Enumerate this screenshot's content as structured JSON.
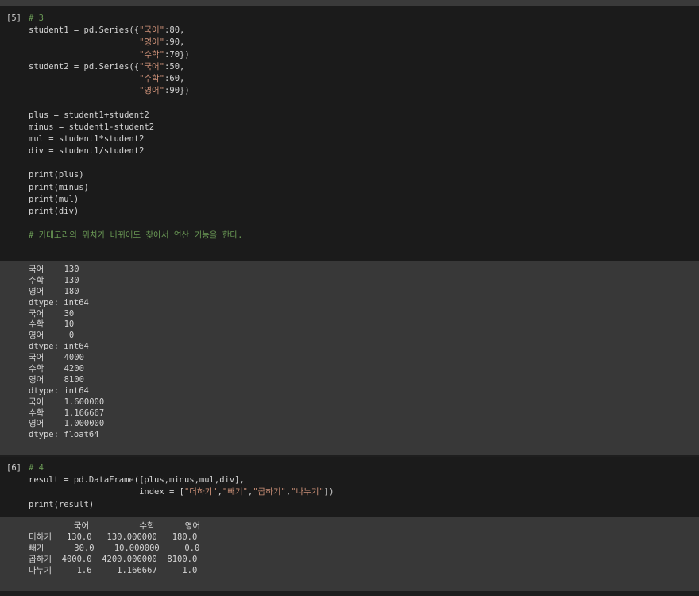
{
  "cells": [
    {
      "prompt": "[5]",
      "code_lines": [
        [
          {
            "t": "# 3",
            "c": "cm"
          }
        ],
        [
          {
            "t": "student1 = pd.Series({",
            "c": "txt"
          },
          {
            "t": "\"국어\"",
            "c": "str"
          },
          {
            "t": ":80,",
            "c": "txt"
          }
        ],
        [
          {
            "t": "                      ",
            "c": "txt"
          },
          {
            "t": "\"영어\"",
            "c": "str"
          },
          {
            "t": ":90,",
            "c": "txt"
          }
        ],
        [
          {
            "t": "                      ",
            "c": "txt"
          },
          {
            "t": "\"수학\"",
            "c": "str"
          },
          {
            "t": ":70})",
            "c": "txt"
          }
        ],
        [
          {
            "t": "student2 = pd.Series({",
            "c": "txt"
          },
          {
            "t": "\"국어\"",
            "c": "str"
          },
          {
            "t": ":50,",
            "c": "txt"
          }
        ],
        [
          {
            "t": "                      ",
            "c": "txt"
          },
          {
            "t": "\"수학\"",
            "c": "str"
          },
          {
            "t": ":60,",
            "c": "txt"
          }
        ],
        [
          {
            "t": "                      ",
            "c": "txt"
          },
          {
            "t": "\"영어\"",
            "c": "str"
          },
          {
            "t": ":90})",
            "c": "txt"
          }
        ],
        [
          {
            "t": "",
            "c": "txt"
          }
        ],
        [
          {
            "t": "plus = student1+student2",
            "c": "txt"
          }
        ],
        [
          {
            "t": "minus = student1-student2",
            "c": "txt"
          }
        ],
        [
          {
            "t": "mul = student1*student2",
            "c": "txt"
          }
        ],
        [
          {
            "t": "div = student1/student2",
            "c": "txt"
          }
        ],
        [
          {
            "t": "",
            "c": "txt"
          }
        ],
        [
          {
            "t": "print(plus)",
            "c": "txt"
          }
        ],
        [
          {
            "t": "print(minus)",
            "c": "txt"
          }
        ],
        [
          {
            "t": "print(mul)",
            "c": "txt"
          }
        ],
        [
          {
            "t": "print(div)",
            "c": "txt"
          }
        ],
        [
          {
            "t": "",
            "c": "txt"
          }
        ],
        [
          {
            "t": "# 카테고리의 위치가 바뀌어도 찾아서 연산 기능을 한다.",
            "c": "cm"
          }
        ]
      ],
      "output_lines": [
        "국어    130",
        "수학    130",
        "영어    180",
        "dtype: int64",
        "국어    30",
        "수학    10",
        "영어     0",
        "dtype: int64",
        "국어    4000",
        "수학    4200",
        "영어    8100",
        "dtype: int64",
        "국어    1.600000",
        "수학    1.166667",
        "영어    1.000000",
        "dtype: float64"
      ]
    },
    {
      "prompt": "[6]",
      "code_lines": [
        [
          {
            "t": "# 4",
            "c": "cm"
          }
        ],
        [
          {
            "t": "result = pd.DataFrame([plus,minus,mul,div],",
            "c": "txt"
          }
        ],
        [
          {
            "t": "                      index = [",
            "c": "txt"
          },
          {
            "t": "\"더하기\"",
            "c": "str"
          },
          {
            "t": ",",
            "c": "txt"
          },
          {
            "t": "\"빼기\"",
            "c": "str"
          },
          {
            "t": ",",
            "c": "txt"
          },
          {
            "t": "\"곱하기\"",
            "c": "str"
          },
          {
            "t": ",",
            "c": "txt"
          },
          {
            "t": "\"나누기\"",
            "c": "str"
          },
          {
            "t": "])",
            "c": "txt"
          }
        ],
        [
          {
            "t": "print(result)",
            "c": "txt"
          }
        ]
      ],
      "output_lines": [
        "         국어          수학      영어",
        "더하기   130.0   130.000000   180.0",
        "빼기      30.0    10.000000     0.0",
        "곱하기  4000.0  4200.000000  8100.0",
        "나누기     1.6     1.166667     1.0"
      ]
    }
  ]
}
